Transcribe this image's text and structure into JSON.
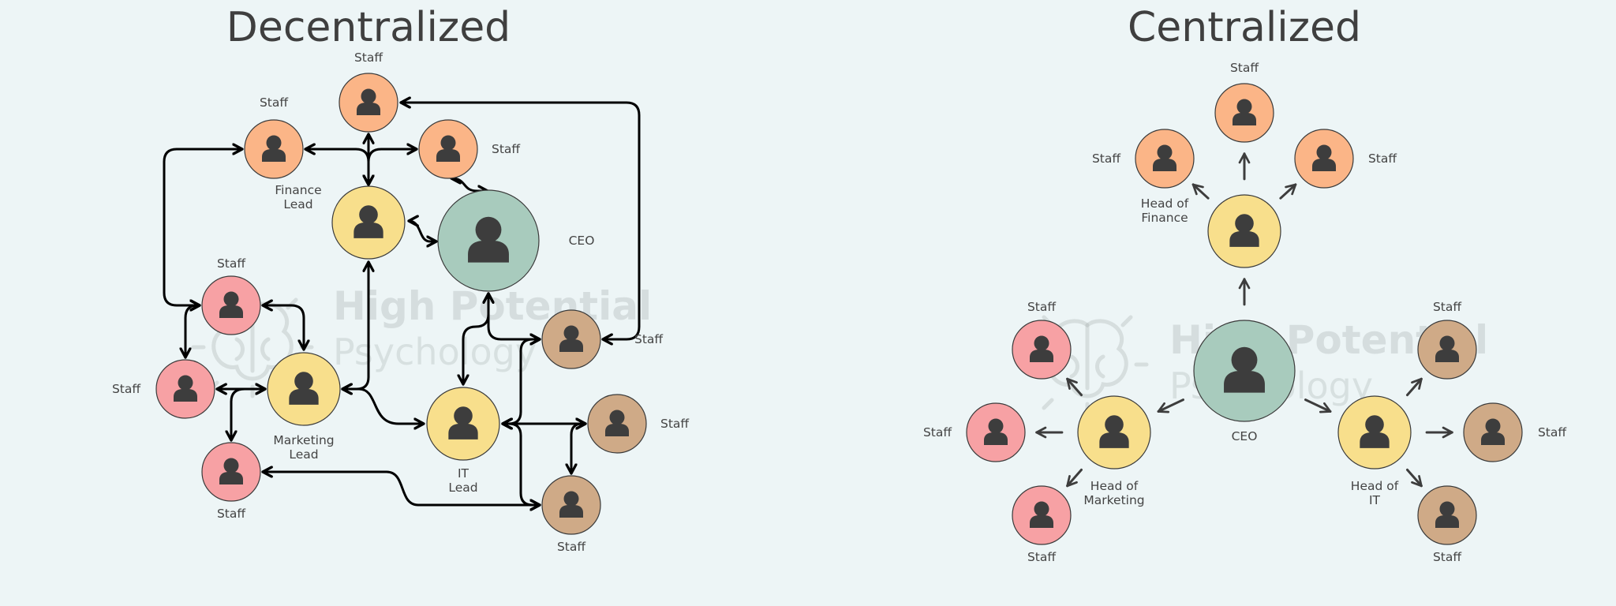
{
  "colors": {
    "background": "#EDF5F6",
    "ceo": "#A8CBBD",
    "lead": "#F8DF8C",
    "finance_staff": "#FBB587",
    "marketing_staff": "#F7A1A4",
    "it_staff": "#CFAA87",
    "icon": "#3d3d3d",
    "connector_decentralized": "#000000",
    "connector_centralized": "#3d3d3d"
  },
  "watermark": {
    "line1": "High Potential",
    "line2": "Psychology",
    "icon": "brain-lightbulb-icon"
  },
  "decentralized": {
    "title": "Decentralized",
    "nodes": [
      {
        "id": "d-ceo",
        "role": "ceo",
        "label": "CEO"
      },
      {
        "id": "d-fin-lead",
        "role": "lead",
        "label": "Finance Lead"
      },
      {
        "id": "d-mkt-lead",
        "role": "lead",
        "label": "Marketing Lead"
      },
      {
        "id": "d-it-lead",
        "role": "lead",
        "label": "IT Lead"
      },
      {
        "id": "d-fin-staff-top",
        "role": "finance_staff",
        "label": "Staff"
      },
      {
        "id": "d-fin-staff-left",
        "role": "finance_staff",
        "label": "Staff"
      },
      {
        "id": "d-fin-staff-right",
        "role": "finance_staff",
        "label": "Staff"
      },
      {
        "id": "d-mkt-staff-top",
        "role": "marketing_staff",
        "label": "Staff"
      },
      {
        "id": "d-mkt-staff-left",
        "role": "marketing_staff",
        "label": "Staff"
      },
      {
        "id": "d-mkt-staff-bottom",
        "role": "marketing_staff",
        "label": "Staff"
      },
      {
        "id": "d-it-staff-top",
        "role": "it_staff",
        "label": "Staff"
      },
      {
        "id": "d-it-staff-right",
        "role": "it_staff",
        "label": "Staff"
      },
      {
        "id": "d-it-staff-bottom",
        "role": "it_staff",
        "label": "Staff"
      }
    ],
    "connections": [
      {
        "from": "d-fin-lead",
        "to": "d-fin-staff-top",
        "direction": "both"
      },
      {
        "from": "d-fin-lead",
        "to": "d-fin-staff-left",
        "direction": "both"
      },
      {
        "from": "d-fin-lead",
        "to": "d-fin-staff-right",
        "direction": "both"
      },
      {
        "from": "d-fin-lead",
        "to": "d-ceo",
        "direction": "both"
      },
      {
        "from": "d-fin-staff-right",
        "to": "d-ceo",
        "direction": "both"
      },
      {
        "from": "d-fin-staff-left",
        "to": "d-mkt-staff-top",
        "direction": "both"
      },
      {
        "from": "d-fin-staff-top",
        "to": "d-it-staff-top",
        "direction": "both"
      },
      {
        "from": "d-mkt-lead",
        "to": "d-fin-lead",
        "direction": "both"
      },
      {
        "from": "d-mkt-lead",
        "to": "d-mkt-staff-top",
        "direction": "both"
      },
      {
        "from": "d-mkt-lead",
        "to": "d-mkt-staff-left",
        "direction": "both"
      },
      {
        "from": "d-mkt-lead",
        "to": "d-mkt-staff-bottom",
        "direction": "both"
      },
      {
        "from": "d-mkt-staff-top",
        "to": "d-mkt-staff-left",
        "direction": "both"
      },
      {
        "from": "d-mkt-lead",
        "to": "d-it-lead",
        "direction": "both"
      },
      {
        "from": "d-ceo",
        "to": "d-it-lead",
        "direction": "both"
      },
      {
        "from": "d-ceo",
        "to": "d-it-staff-top",
        "direction": "both"
      },
      {
        "from": "d-it-lead",
        "to": "d-it-staff-top",
        "direction": "both"
      },
      {
        "from": "d-it-lead",
        "to": "d-it-staff-right",
        "direction": "both"
      },
      {
        "from": "d-it-lead",
        "to": "d-it-staff-bottom",
        "direction": "both"
      },
      {
        "from": "d-it-staff-right",
        "to": "d-it-staff-bottom",
        "direction": "both"
      },
      {
        "from": "d-mkt-staff-bottom",
        "to": "d-it-staff-bottom",
        "direction": "both"
      }
    ]
  },
  "centralized": {
    "title": "Centralized",
    "nodes": [
      {
        "id": "c-ceo",
        "role": "ceo",
        "label": "CEO"
      },
      {
        "id": "c-fin-head",
        "role": "lead",
        "label": "Head of Finance"
      },
      {
        "id": "c-mkt-head",
        "role": "lead",
        "label": "Head of Marketing"
      },
      {
        "id": "c-it-head",
        "role": "lead",
        "label": "Head of IT"
      },
      {
        "id": "c-fin-staff-top",
        "role": "finance_staff",
        "label": "Staff"
      },
      {
        "id": "c-fin-staff-left",
        "role": "finance_staff",
        "label": "Staff"
      },
      {
        "id": "c-fin-staff-right",
        "role": "finance_staff",
        "label": "Staff"
      },
      {
        "id": "c-mkt-staff-top",
        "role": "marketing_staff",
        "label": "Staff"
      },
      {
        "id": "c-mkt-staff-left",
        "role": "marketing_staff",
        "label": "Staff"
      },
      {
        "id": "c-mkt-staff-bottom",
        "role": "marketing_staff",
        "label": "Staff"
      },
      {
        "id": "c-it-staff-top",
        "role": "it_staff",
        "label": "Staff"
      },
      {
        "id": "c-it-staff-right",
        "role": "it_staff",
        "label": "Staff"
      },
      {
        "id": "c-it-staff-bottom",
        "role": "it_staff",
        "label": "Staff"
      }
    ],
    "connections": [
      {
        "from": "c-ceo",
        "to": "c-fin-head",
        "direction": "forward"
      },
      {
        "from": "c-ceo",
        "to": "c-mkt-head",
        "direction": "forward"
      },
      {
        "from": "c-ceo",
        "to": "c-it-head",
        "direction": "forward"
      },
      {
        "from": "c-fin-head",
        "to": "c-fin-staff-top",
        "direction": "forward"
      },
      {
        "from": "c-fin-head",
        "to": "c-fin-staff-left",
        "direction": "forward"
      },
      {
        "from": "c-fin-head",
        "to": "c-fin-staff-right",
        "direction": "forward"
      },
      {
        "from": "c-mkt-head",
        "to": "c-mkt-staff-top",
        "direction": "forward"
      },
      {
        "from": "c-mkt-head",
        "to": "c-mkt-staff-left",
        "direction": "forward"
      },
      {
        "from": "c-mkt-head",
        "to": "c-mkt-staff-bottom",
        "direction": "forward"
      },
      {
        "from": "c-it-head",
        "to": "c-it-staff-top",
        "direction": "forward"
      },
      {
        "from": "c-it-head",
        "to": "c-it-staff-right",
        "direction": "forward"
      },
      {
        "from": "c-it-head",
        "to": "c-it-staff-bottom",
        "direction": "forward"
      }
    ]
  }
}
